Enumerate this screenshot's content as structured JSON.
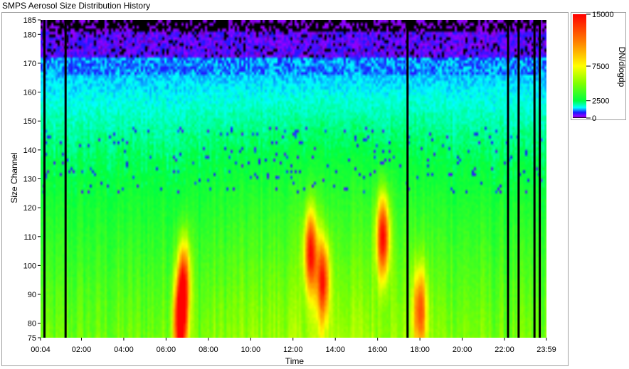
{
  "window": {
    "title": "SMPS Aerosol Size Distribution History"
  },
  "chart_data": {
    "type": "heatmap",
    "title": "SMPS Aerosol Size Distribution History",
    "xlabel": "Time",
    "ylabel": "Size Channel",
    "colorbar_label": "DN/dlogdp",
    "x_range": [
      "00:04",
      "23:59"
    ],
    "x_ticks": [
      "00:04",
      "02:00",
      "04:00",
      "06:00",
      "08:00",
      "10:00",
      "12:00",
      "14:00",
      "16:00",
      "18:00",
      "20:00",
      "22:00",
      "23:59"
    ],
    "y_range": [
      75,
      185
    ],
    "y_ticks": [
      75,
      80,
      90,
      100,
      110,
      120,
      130,
      140,
      150,
      160,
      170,
      180,
      185
    ],
    "color_scale": {
      "min": 0,
      "max": 15000,
      "ticks": [
        0,
        2500,
        7500,
        15000
      ],
      "tick_labels": [
        "0",
        "2500",
        "7500",
        "15000"
      ],
      "stops": [
        {
          "value": 0,
          "color": "#000000"
        },
        {
          "value": 200,
          "color": "#9c00ff"
        },
        {
          "value": 800,
          "color": "#1818ff"
        },
        {
          "value": 1500,
          "color": "#00ffff"
        },
        {
          "value": 2500,
          "color": "#00ff40"
        },
        {
          "value": 5000,
          "color": "#80ff00"
        },
        {
          "value": 7500,
          "color": "#ffff00"
        },
        {
          "value": 11000,
          "color": "#ff8000"
        },
        {
          "value": 15000,
          "color": "#ff0000"
        }
      ]
    },
    "peak_events": [
      {
        "time": "06:40",
        "channel": 80,
        "level": 12500
      },
      {
        "time": "06:50",
        "channel": 95,
        "level": 9000
      },
      {
        "time": "12:50",
        "channel": 105,
        "level": 10500
      },
      {
        "time": "13:25",
        "channel": 95,
        "level": 9500
      },
      {
        "time": "16:15",
        "channel": 110,
        "level": 11500
      },
      {
        "time": "18:00",
        "channel": 85,
        "level": 8000
      }
    ],
    "data_gaps": [
      "00:15",
      "01:15",
      "17:25",
      "22:10",
      "22:40",
      "23:25",
      "23:40"
    ]
  }
}
